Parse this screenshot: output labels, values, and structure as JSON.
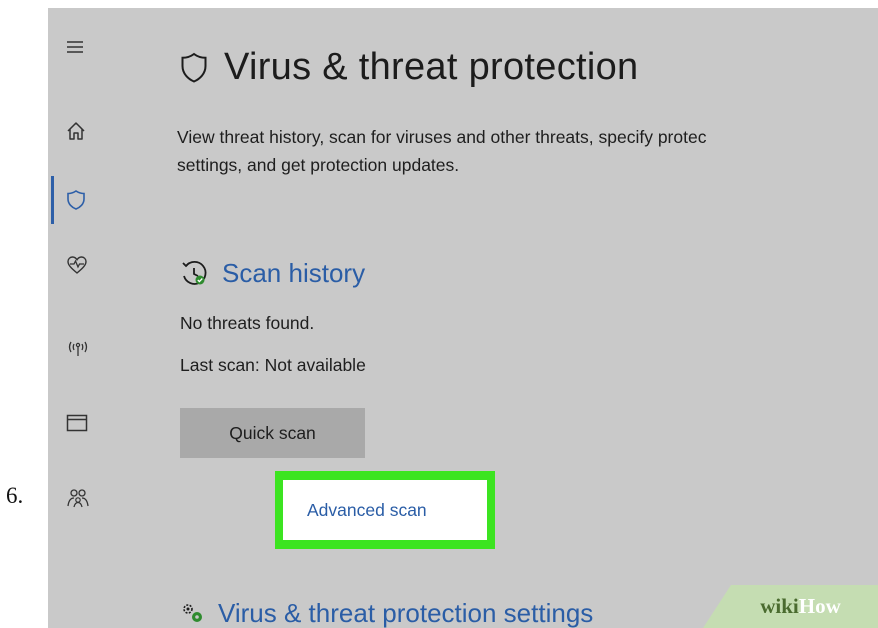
{
  "step_number": "6.",
  "sidebar": {
    "items": [
      {
        "name": "menu",
        "icon": "hamburger-menu-icon"
      },
      {
        "name": "home",
        "icon": "home-icon"
      },
      {
        "name": "virus-threat-protection",
        "icon": "shield-icon",
        "selected": true
      },
      {
        "name": "device-health",
        "icon": "heart-pulse-icon"
      },
      {
        "name": "firewall-network",
        "icon": "wireless-antenna-icon"
      },
      {
        "name": "app-browser-control",
        "icon": "browser-window-icon"
      },
      {
        "name": "family-options",
        "icon": "family-icon"
      }
    ]
  },
  "header": {
    "icon": "shield-icon",
    "title": "Virus & threat protection",
    "description_line1": "View threat history, scan for viruses and other threats, specify protec",
    "description_line2": "settings, and get protection updates."
  },
  "scan_history": {
    "icon": "scan-history-clock-icon",
    "title": "Scan history",
    "status": "No threats found.",
    "last_scan": "Last scan: Not available",
    "quick_scan_label": "Quick scan",
    "advanced_scan_label": "Advanced scan"
  },
  "protection_settings": {
    "icon": "settings-gears-icon",
    "title": "Virus & threat protection settings"
  },
  "watermark": {
    "part1": "wiki",
    "part2": "How"
  },
  "colors": {
    "background": "#c9c9c9",
    "accent_blue": "#2a5da6",
    "highlight_green": "#3ce421",
    "button_gray": "#a9a9a9"
  }
}
